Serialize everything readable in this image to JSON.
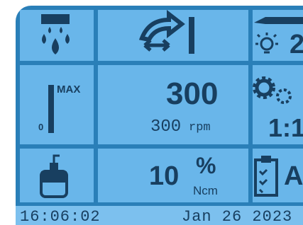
{
  "display": {
    "speed": {
      "value": "300",
      "actual": "300",
      "unit": "rpm"
    },
    "ratio": "1:1",
    "torque": {
      "value": "10",
      "unit_top": "%",
      "unit_bottom": "Ncm"
    },
    "light_level": "2",
    "program_letter": "A",
    "gauge": {
      "max_label": "MAX",
      "min_label": "0"
    }
  },
  "status_bar": {
    "time": "16:06:02",
    "date": "Jan 26 2023"
  },
  "icons": [
    "irrigation-icon",
    "direction-icon",
    "handpiece-light-icon",
    "speed-gauge-icon",
    "gear-ratio-icon",
    "coolant-bottle-icon",
    "program-clipboard-icon"
  ]
}
